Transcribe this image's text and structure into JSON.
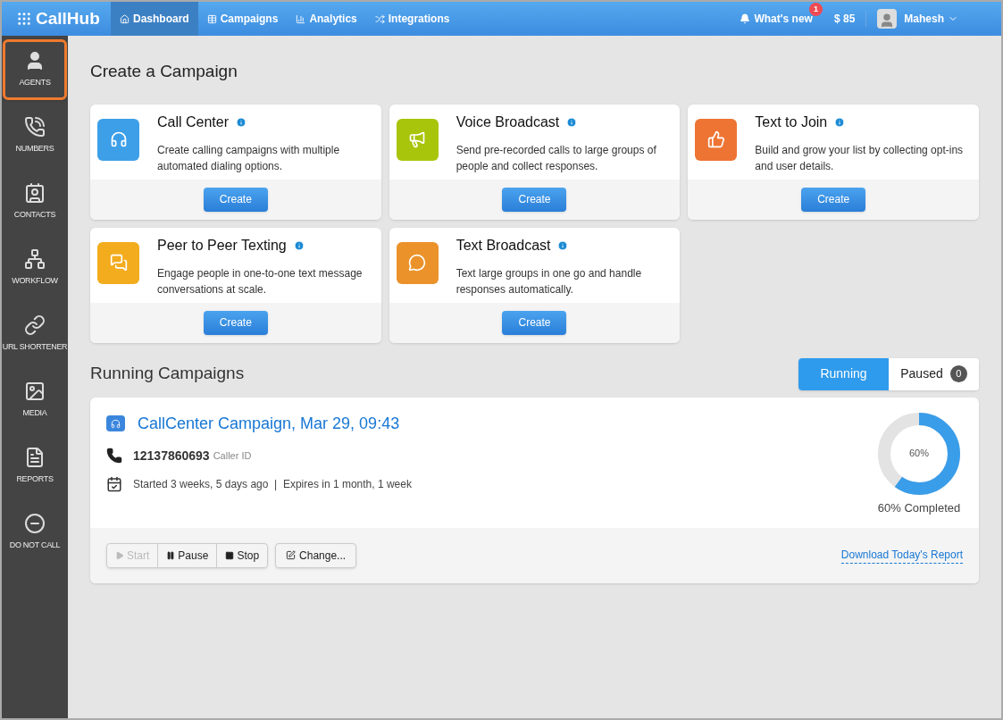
{
  "brand": "CallHub",
  "nav": [
    {
      "label": "Dashboard",
      "selected": true
    },
    {
      "label": "Campaigns",
      "selected": false
    },
    {
      "label": "Analytics",
      "selected": false
    },
    {
      "label": "Integrations",
      "selected": false
    }
  ],
  "whats_new": {
    "label": "What's new",
    "badge": "1"
  },
  "balance": "$ 85",
  "user": "Mahesh",
  "sidebar": [
    {
      "label": "AGENTS",
      "selected": true
    },
    {
      "label": "NUMBERS",
      "selected": false
    },
    {
      "label": "CONTACTS",
      "selected": false
    },
    {
      "label": "WORKFLOW",
      "selected": false
    },
    {
      "label": "URL SHORTENER",
      "selected": false
    },
    {
      "label": "MEDIA",
      "selected": false
    },
    {
      "label": "REPORTS",
      "selected": false
    },
    {
      "label": "DO NOT CALL",
      "selected": false
    }
  ],
  "create_title": "Create a Campaign",
  "campaign_types": [
    {
      "title": "Call Center",
      "description": "Create calling campaigns with multiple automated dialing options.",
      "button": "Create",
      "color": "#3d9fe8"
    },
    {
      "title": "Voice Broadcast",
      "description": "Send pre-recorded calls to large groups of people and collect responses.",
      "button": "Create",
      "color": "#a9c50b"
    },
    {
      "title": "Text to Join",
      "description": "Build and grow your list by collecting opt-ins and user details.",
      "button": "Create",
      "color": "#ee7434"
    },
    {
      "title": "Peer to Peer Texting",
      "description": "Engage people in one-to-one text message conversations at scale.",
      "button": "Create",
      "color": "#f3ac1e"
    },
    {
      "title": "Text Broadcast",
      "description": "Text large groups in one go and handle responses automatically.",
      "button": "Create",
      "color": "#eb922a"
    }
  ],
  "running_title": "Running Campaigns",
  "filter_tabs": [
    {
      "label": "Running",
      "selected": true
    },
    {
      "label": "Paused",
      "count": "0",
      "selected": false
    }
  ],
  "campaign": {
    "name": "CallCenter Campaign, Mar 29, 09:43",
    "number": "12137860693",
    "number_label": "Caller ID",
    "dates": "Started 3 weeks, 5 days ago  |  Expires in 1 month, 1 week",
    "level": 0.6,
    "percent": "60%",
    "completed": "60% Completed",
    "actions": [
      {
        "label": "Start",
        "disabled": true
      },
      {
        "label": "Pause",
        "disabled": false
      },
      {
        "label": "Stop",
        "disabled": false
      }
    ],
    "change": "Change...",
    "report_link": "Download Today's Report"
  }
}
